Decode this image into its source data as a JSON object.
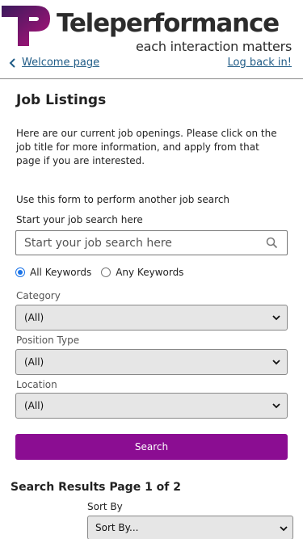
{
  "header": {
    "brand": "Teleperformance",
    "tagline": "each interaction matters",
    "back_label": "Welcome page",
    "logout_label": "Log back in!",
    "colors": {
      "brand_purple": "#8b0d92",
      "link": "#1f5b86"
    }
  },
  "main": {
    "title": "Job Listings",
    "intro": "Here are our current job openings. Please click on the job title for more information, and apply from that page if you are interested.",
    "form_hint": "Use this form to perform another job search",
    "search_label": "Start your job search here",
    "search_placeholder": "Start your job search here",
    "keyword_options": [
      {
        "label": "All Keywords",
        "selected": true
      },
      {
        "label": "Any Keywords",
        "selected": false
      }
    ],
    "filters": [
      {
        "label": "Category",
        "value": "(All)"
      },
      {
        "label": "Position Type",
        "value": "(All)"
      },
      {
        "label": "Location",
        "value": "(All)"
      }
    ],
    "search_button": "Search"
  },
  "results": {
    "title": "Search Results Page 1 of 2",
    "sort_label": "Sort By",
    "sort_value": "Sort By..."
  }
}
